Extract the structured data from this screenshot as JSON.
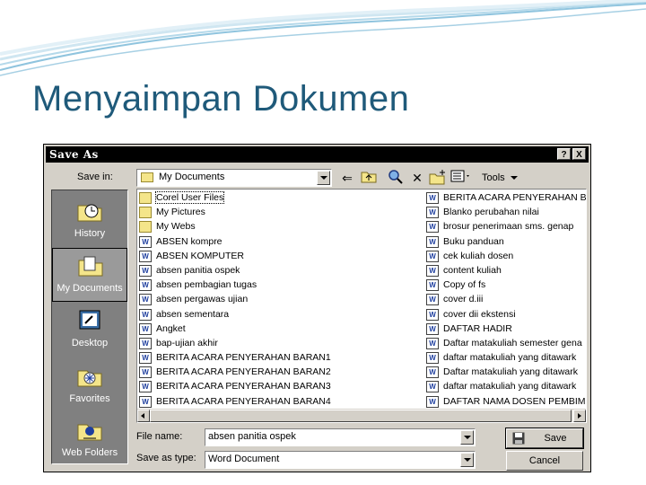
{
  "slide": {
    "title": "Menyaimpan Dokumen"
  },
  "dialog": {
    "title": "Save As",
    "help_label": "?",
    "close_label": "X",
    "save_in_label": "Save in:",
    "save_in_value": "My Documents",
    "tools_label": "Tools",
    "places": [
      {
        "label": "History",
        "icon": "history-icon"
      },
      {
        "label": "My Documents",
        "icon": "my-documents-icon"
      },
      {
        "label": "Desktop",
        "icon": "desktop-icon"
      },
      {
        "label": "Favorites",
        "icon": "favorites-icon"
      },
      {
        "label": "Web Folders",
        "icon": "web-folders-icon"
      }
    ],
    "files_left": [
      {
        "name": "Corel User Files",
        "type": "folder"
      },
      {
        "name": "My Pictures",
        "type": "folder"
      },
      {
        "name": "My Webs",
        "type": "folder"
      },
      {
        "name": "ABSEN kompre",
        "type": "doc"
      },
      {
        "name": "ABSEN KOMPUTER",
        "type": "doc"
      },
      {
        "name": "absen panitia ospek",
        "type": "doc"
      },
      {
        "name": "absen pembagian tugas",
        "type": "doc"
      },
      {
        "name": "absen pergawas ujian",
        "type": "doc"
      },
      {
        "name": "absen sementara",
        "type": "doc"
      },
      {
        "name": "Angket",
        "type": "doc"
      },
      {
        "name": "bap-ujian akhir",
        "type": "doc"
      },
      {
        "name": "BERITA ACARA PENYERAHAN BARAN1",
        "type": "doc"
      },
      {
        "name": "BERITA ACARA PENYERAHAN BARAN2",
        "type": "doc"
      },
      {
        "name": "BERITA ACARA PENYERAHAN BARAN3",
        "type": "doc"
      },
      {
        "name": "BERITA ACARA PENYERAHAN BARAN4",
        "type": "doc"
      }
    ],
    "files_right": [
      {
        "name": "BERITA ACARA PENYERAHAN BA",
        "type": "doc"
      },
      {
        "name": "Blanko perubahan nilai",
        "type": "doc"
      },
      {
        "name": "brosur penerimaan sms. genap",
        "type": "doc"
      },
      {
        "name": "Buku panduan",
        "type": "doc"
      },
      {
        "name": "cek kuliah dosen",
        "type": "doc"
      },
      {
        "name": "content kuliah",
        "type": "doc"
      },
      {
        "name": "Copy of fs",
        "type": "doc"
      },
      {
        "name": "cover d.iii",
        "type": "doc"
      },
      {
        "name": "cover dii ekstensi",
        "type": "doc"
      },
      {
        "name": "DAFTAR HADIR",
        "type": "doc"
      },
      {
        "name": "Daftar matakuliah semester gena",
        "type": "doc"
      },
      {
        "name": "daftar matakuliah yang ditawark",
        "type": "doc"
      },
      {
        "name": "Daftar matakuliah yang ditawark",
        "type": "doc"
      },
      {
        "name": "daftar matakuliah yang ditawark",
        "type": "doc"
      },
      {
        "name": "DAFTAR NAMA DOSEN PEMBIMB",
        "type": "doc"
      }
    ],
    "file_name_label": "File name:",
    "file_name_value": "absen panitia ospek",
    "save_as_type_label": "Save as type:",
    "save_as_type_value": "Word Document",
    "save_button": "Save",
    "cancel_button": "Cancel"
  },
  "colors": {
    "title": "#1f5a7a",
    "dialog_face": "#d4d0c8",
    "titlebar": "#000000",
    "places_bg": "#808080"
  }
}
